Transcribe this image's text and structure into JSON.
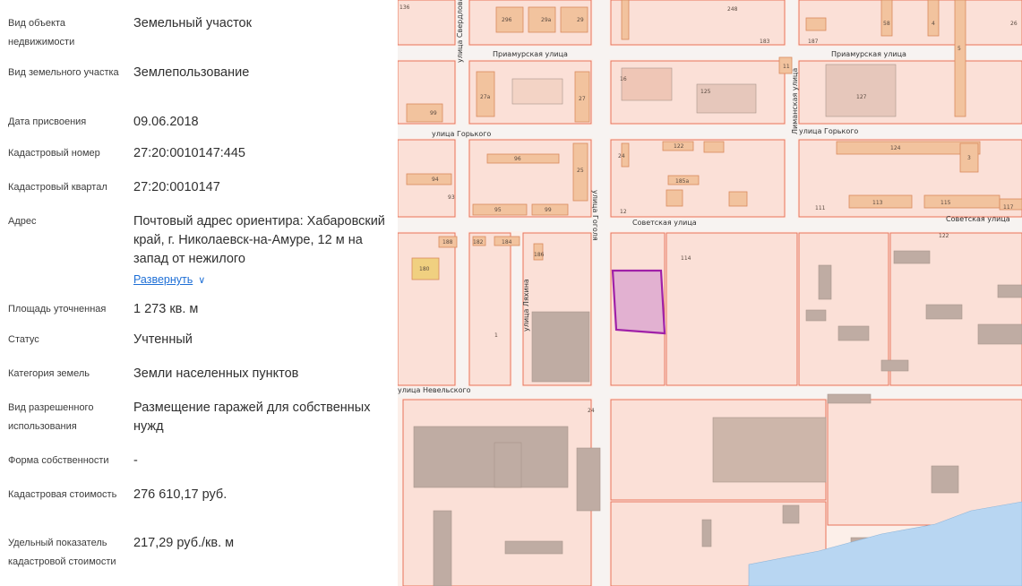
{
  "properties": [
    {
      "label": "Вид объекта недвижимости",
      "value": "Земельный участок"
    },
    {
      "label": "Вид земельного участка",
      "value": "Землепользование"
    },
    {
      "label": "Дата присвоения",
      "value": "09.06.2018"
    },
    {
      "label": "Кадастровый номер",
      "value": "27:20:0010147:445"
    },
    {
      "label": "Кадастровый квартал",
      "value": "27:20:0010147"
    },
    {
      "label": "Адрес",
      "value": "Почтовый адрес ориентира: Хабаровский край, г. Николаевск-на-Амуре, 12 м на запад от нежилого"
    },
    {
      "label": "Площадь уточненная",
      "value": "1 273 кв. м"
    },
    {
      "label": "Статус",
      "value": "Учтенный"
    },
    {
      "label": "Категория земель",
      "value": "Земли населенных пунктов"
    },
    {
      "label": "Вид разрешенного использования",
      "value": "Размещение гаражей для собственных нужд"
    },
    {
      "label": "Форма собственности",
      "value": "-"
    },
    {
      "label": "Кадастровая стоимость",
      "value": "276 610,17 руб."
    },
    {
      "label": "Удельный показатель кадастровой стоимости",
      "value": "217,29 руб./кв. м"
    }
  ],
  "address_expand": {
    "label": "Развернуть",
    "icon": "chevron-down-icon"
  },
  "map": {
    "street_labels": {
      "priamurskaya_1": "Приамурская улица",
      "priamurskaya_2": "Приамурская улица",
      "gorkogo_1": "улица Горького",
      "gorkogo_2": "улица Горького",
      "sovetskaya_1": "Советская улица",
      "sovetskaya_2": "Советская улица",
      "nevelskogo": "улица Невельского",
      "sverdlova": "улица Свердлова",
      "gogolya": "улица Гоголя",
      "lyakina": "улица Ляхина",
      "limanskaya": "Лиманская улица"
    },
    "building_numbers": {
      "n296": "296",
      "n29a": "29а",
      "n29": "29",
      "n1": "1",
      "n27a": "27а",
      "n27": "27",
      "n99": "99",
      "n16": "16",
      "n125": "125",
      "n127": "127",
      "n96": "96",
      "n25": "25",
      "n94": "94",
      "n93": "93",
      "n95": "95",
      "n99b": "99",
      "n24": "24",
      "n122": "122",
      "n124": "124",
      "n12": "12",
      "n185a": "185а",
      "n111": "111",
      "n113": "113",
      "n115": "115",
      "n117": "117",
      "n3": "3",
      "n188": "188",
      "n182": "182",
      "n184": "184",
      "n186": "186",
      "n180": "180",
      "n114": "114",
      "n1b": "1",
      "n24b": "24",
      "n183": "183",
      "n187": "187",
      "n11": "11",
      "n58": "58",
      "n5": "5",
      "n4": "4",
      "n26": "26",
      "n136": "136",
      "n248": "248",
      "n122b": "122"
    },
    "colors": {
      "parcel_fill": "#fbe0d7",
      "parcel_stroke": "#e8735a",
      "building": "#f2c39e",
      "structure": "#bfaca3",
      "water": "#b8d6f2",
      "selected": "#a020a8"
    }
  }
}
